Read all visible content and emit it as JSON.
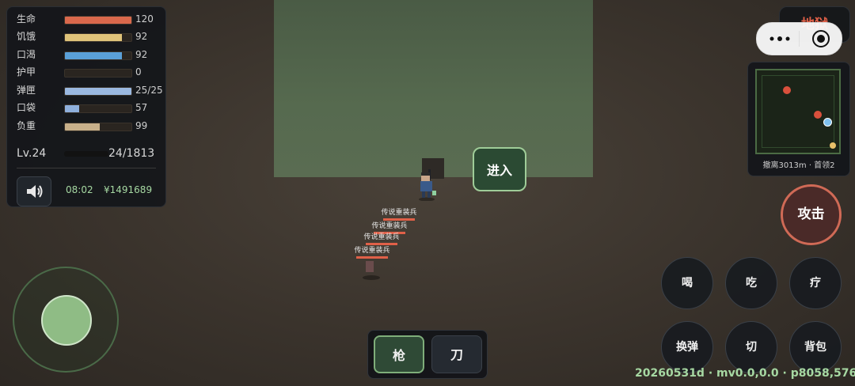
{
  "stats": [
    {
      "label": "生命",
      "value": "120",
      "fill": 1.0,
      "color": "#d9684c"
    },
    {
      "label": "饥饿",
      "value": "92",
      "fill": 0.86,
      "color": "#dfc37a"
    },
    {
      "label": "口渴",
      "value": "92",
      "fill": 0.86,
      "color": "#5aa0d8"
    },
    {
      "label": "护甲",
      "value": "0",
      "fill": 0.0,
      "color": "#8a8a8a"
    },
    {
      "label": "弹匣",
      "value": "25/25",
      "fill": 1.0,
      "color": "#9ab8e0"
    },
    {
      "label": "口袋",
      "value": "57",
      "fill": 0.22,
      "color": "#8fb0dc"
    },
    {
      "label": "负重",
      "value": "99",
      "fill": 0.52,
      "color": "#c8b08a"
    }
  ],
  "level": {
    "label": "Lv.24",
    "xp": "24/1813"
  },
  "status": {
    "time": "08:02",
    "money": "¥1491689"
  },
  "top_right": {
    "hell_label": "地狱"
  },
  "minimap": {
    "caption": "撤离3013m · 首领2"
  },
  "enter_label": "进入",
  "enemies": [
    {
      "name": "传说重装兵"
    },
    {
      "name": "传说重装兵"
    },
    {
      "name": "传说重装兵"
    },
    {
      "name": "传说重装兵"
    }
  ],
  "weapons": {
    "gun": "枪",
    "knife": "刀"
  },
  "actions": {
    "attack": "攻击",
    "drink": "喝",
    "eat": "吃",
    "heal": "疗",
    "reload": "换弹",
    "switch": "切",
    "bag": "背包"
  },
  "footer": "20260531d · mv0.0,0.0 · p8058,5762",
  "colors": {
    "accent_green": "#a6d8a2",
    "danger": "#e06048"
  }
}
